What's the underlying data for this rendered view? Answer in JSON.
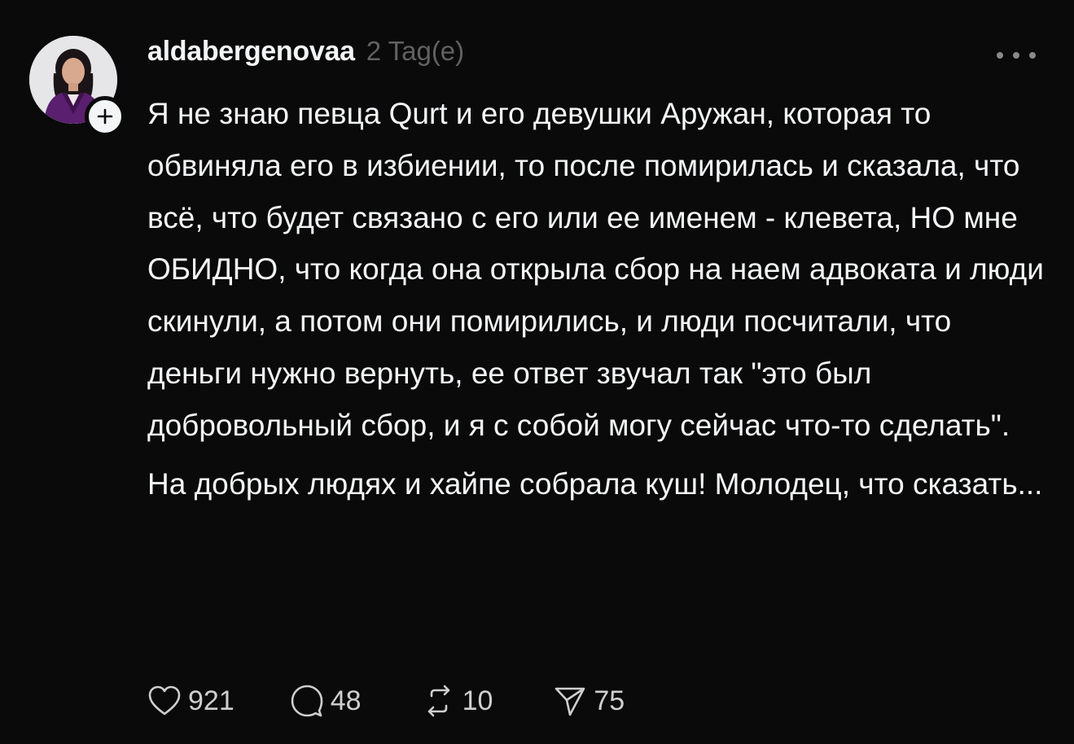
{
  "post": {
    "author": {
      "username": "aldabergenovaa",
      "time_ago": "2 Tag(e)",
      "avatar_icon": "profile-photo",
      "follow_icon": "plus-icon"
    },
    "menu_icon": "more-horizontal-icon",
    "paragraphs": [
      "Я не знаю певца Qurt и его девушки Аружан, которая то обвиняла его в избиении, то после помирилась и сказала, что всё, что будет связано с его или ее именем - клевета, НО мне ОБИДНО, что когда она открыла сбор на наем адвоката и люди скинули, а потом они помирились, и люди посчитали, что деньги нужно вернуть, ее ответ звучал так \"это был добровольный сбор, и я с собой могу сейчас что-то сделать\".",
      "На добрых людях и хайпе собрала куш! Молодец, что сказать..."
    ],
    "actions": {
      "likes": "921",
      "replies": "48",
      "reposts": "10",
      "shares": "75"
    }
  },
  "colors": {
    "background": "#0a0a0a",
    "text": "#f3f5f7",
    "secondary": "#616161",
    "icon": "#cfcfcf"
  }
}
